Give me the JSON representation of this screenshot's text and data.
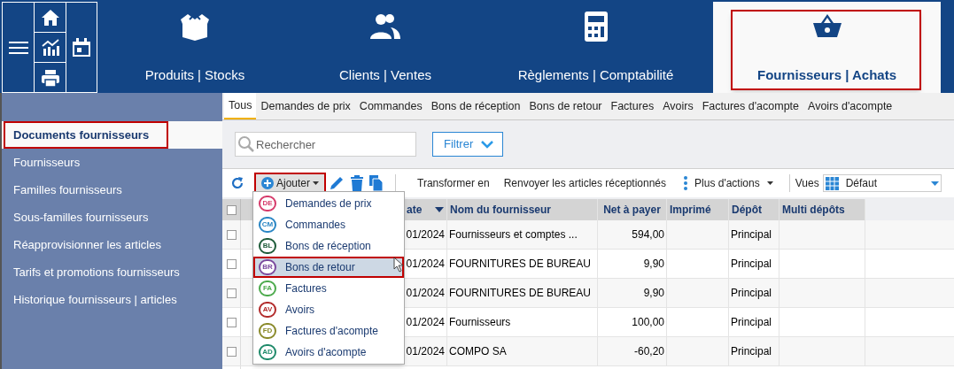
{
  "modules": [
    {
      "label": "Produits | Stocks",
      "selected": false,
      "highlighted": false
    },
    {
      "label": "Clients | Ventes",
      "selected": false,
      "highlighted": false
    },
    {
      "label": "Règlements | Comptabilité",
      "selected": false,
      "highlighted": false
    },
    {
      "label": "Fournisseurs | Achats",
      "selected": true,
      "highlighted": true
    }
  ],
  "sidebar": {
    "items": [
      {
        "label": "Documents fournisseurs",
        "selected": true,
        "highlighted": true
      },
      {
        "label": "Fournisseurs",
        "selected": false,
        "highlighted": false
      },
      {
        "label": "Familles fournisseurs",
        "selected": false,
        "highlighted": false
      },
      {
        "label": "Sous-familles fournisseurs",
        "selected": false,
        "highlighted": false
      },
      {
        "label": "Réapprovisionner les articles",
        "selected": false,
        "highlighted": false
      },
      {
        "label": "Tarifs et promotions fournisseurs",
        "selected": false,
        "highlighted": false
      },
      {
        "label": "Historique fournisseurs | articles",
        "selected": false,
        "highlighted": false
      }
    ]
  },
  "tabs": [
    {
      "label": "Tous",
      "selected": true
    },
    {
      "label": "Demandes de prix",
      "selected": false
    },
    {
      "label": "Commandes",
      "selected": false
    },
    {
      "label": "Bons de réception",
      "selected": false
    },
    {
      "label": "Bons de retour",
      "selected": false
    },
    {
      "label": "Factures",
      "selected": false
    },
    {
      "label": "Avoirs",
      "selected": false
    },
    {
      "label": "Factures d'acompte",
      "selected": false
    },
    {
      "label": "Avoirs d'acompte",
      "selected": false
    }
  ],
  "search": {
    "placeholder": "Rechercher"
  },
  "filter_button": "Filtrer",
  "toolbar": {
    "add_button": "Ajouter",
    "add_highlighted": true,
    "transform": "Transformer en",
    "resend": "Renvoyer les articles réceptionnés",
    "more": "Plus d'actions",
    "views_label": "Vues",
    "views_value": "Défaut"
  },
  "add_menu": [
    {
      "badge": "DE",
      "label": "Demandes de prix",
      "color": "#d63a6a",
      "selected": false
    },
    {
      "badge": "CM",
      "label": "Commandes",
      "color": "#2a86c4",
      "selected": false
    },
    {
      "badge": "BL",
      "label": "Bons de réception",
      "color": "#1f5c3a",
      "selected": false
    },
    {
      "badge": "BR",
      "label": "Bons de retour",
      "color": "#7b4a9e",
      "selected": true
    },
    {
      "badge": "FA",
      "label": "Factures",
      "color": "#4caa4c",
      "selected": false
    },
    {
      "badge": "AV",
      "label": "Avoirs",
      "color": "#b22a2a",
      "selected": false
    },
    {
      "badge": "FD",
      "label": "Factures d'acompte",
      "color": "#8a8a2a",
      "selected": false
    },
    {
      "badge": "AD",
      "label": "Avoirs d'acompte",
      "color": "#1f8a6a",
      "selected": false
    }
  ],
  "table": {
    "header_checked": false,
    "columns": [
      "ate",
      "Nom du fournisseur",
      "Net à payer",
      "Imprimé",
      "Dépôt",
      "Multi dépôts"
    ],
    "rows": [
      {
        "checked": false,
        "cells": [
          "01/2024",
          "Fournisseurs et comptes ...",
          "594,00",
          "",
          "Principal",
          ""
        ]
      },
      {
        "checked": false,
        "cells": [
          "01/2024",
          "FOURNITURES DE BUREAU",
          "9,90",
          "",
          "Principal",
          ""
        ]
      },
      {
        "checked": false,
        "cells": [
          "01/2024",
          "FOURNITURES DE BUREAU",
          "9,90",
          "",
          "Principal",
          ""
        ]
      },
      {
        "checked": false,
        "cells": [
          "01/2024",
          "Fournisseurs",
          "100,00",
          "",
          "Principal",
          ""
        ]
      },
      {
        "checked": false,
        "cells": [
          "01/2024",
          "COMPO SA",
          "-60,20",
          "",
          "Principal",
          ""
        ]
      }
    ]
  }
}
